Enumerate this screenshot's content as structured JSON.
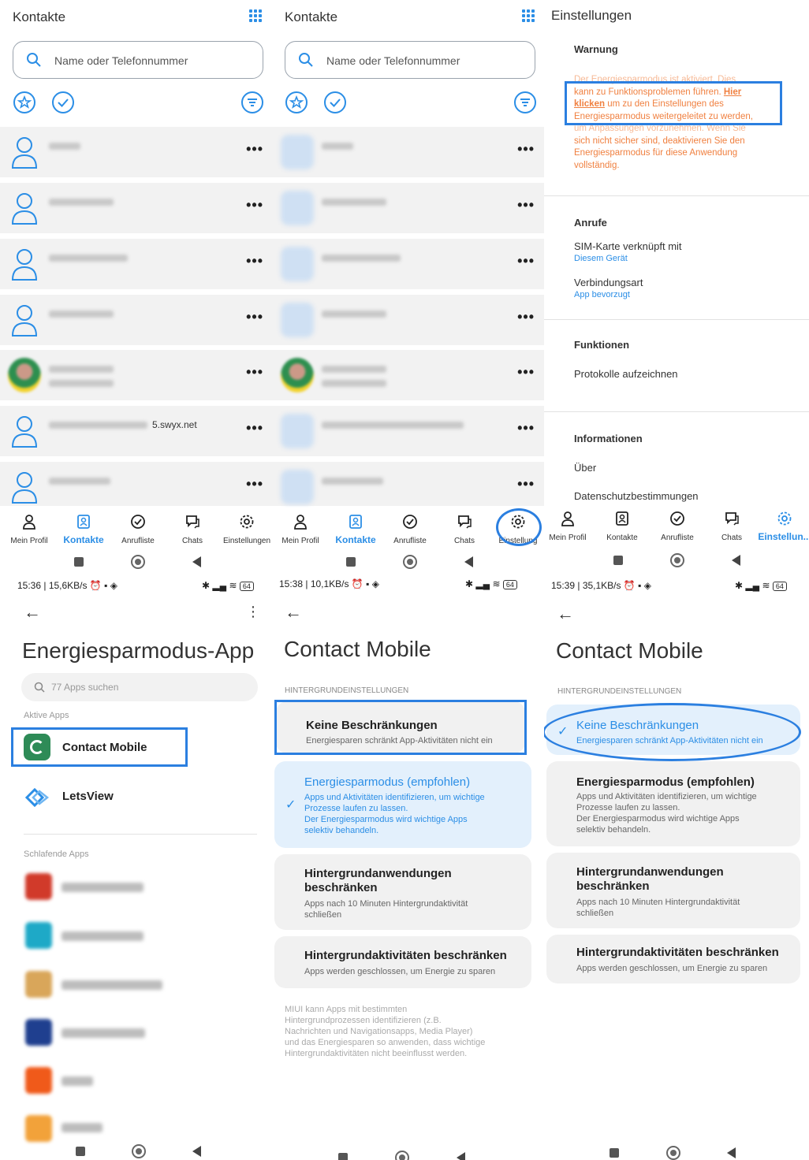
{
  "contacts": {
    "title": "Kontakte",
    "search_placeholder": "Name oder Telefonnummer",
    "row_dots": "•••",
    "row_suffix": "5.swyx.net"
  },
  "nav": {
    "profile": "Mein Profil",
    "contacts": "Kontakte",
    "calls": "Anrufliste",
    "chats": "Chats",
    "settings": "Einstellungen",
    "settings_short": "Einstellun...",
    "settings_cut": "Einstellung"
  },
  "settings": {
    "title": "Einstellungen",
    "warning_head": "Warnung",
    "warning_text_1": "Der Energiesparmodus ist aktiviert. Dies",
    "warning_text_2": "kann zu Funktionsproblemen führen.",
    "warning_link_1": "Hier",
    "warning_link_2": "klicken",
    "warning_text_3": "um zu den Einstellungen des",
    "warning_text_4": "Energiesparmodus weitergeleitet zu werden,",
    "warning_text_5": "um Anpassungen vorzunehmen. Wenn Sie",
    "warning_text_6": "sich nicht sicher sind, deaktivieren Sie den",
    "warning_text_7": "Energiesparmodus für diese Anwendung",
    "warning_text_8": "vollständig.",
    "calls_head": "Anrufe",
    "sim_label": "SIM-Karte verknüpft mit",
    "sim_value": "Diesem Gerät",
    "conn_label": "Verbindungsart",
    "conn_value": "App bevorzugt",
    "func_head": "Funktionen",
    "logs": "Protokolle aufzeichnen",
    "info_head": "Informationen",
    "about": "Über",
    "privacy": "Datenschutzbestimmungen"
  },
  "status": {
    "s1": "15:36 | 15,6KB/s",
    "s2": "15:38 | 10,1KB/s",
    "s3": "15:39 | 35,1KB/s",
    "battery": "64"
  },
  "battery_app": {
    "title": "Energiesparmodus-App",
    "search": "77 Apps suchen",
    "active_head": "Aktive Apps",
    "app1": "Contact Mobile",
    "app2": "LetsView",
    "sleeping_head": "Schlafende Apps"
  },
  "detail": {
    "title": "Contact Mobile",
    "section": "HINTERGRUNDEINSTELLUNGEN",
    "opt1_title": "Keine Beschränkungen",
    "opt1_sub": "Energiesparen schränkt App-Aktivitäten nicht ein",
    "opt2_title": "Energiesparmodus (empfohlen)",
    "opt2_sub_1": "Apps und Aktivitäten identifizieren, um wichtige",
    "opt2_sub_2": "Prozesse laufen zu lassen.",
    "opt2_sub_3": "Der Energiesparmodus wird wichtige Apps",
    "opt2_sub_4": "selektiv behandeln.",
    "opt3_title_1": "Hintergrundanwendungen",
    "opt3_title_2": "beschränken",
    "opt3_sub_1": "Apps nach 10 Minuten Hintergrundaktivität",
    "opt3_sub_2": "schließen",
    "opt4_title": "Hintergrundaktivitäten beschränken",
    "opt4_sub": "Apps werden geschlossen, um Energie zu sparen",
    "note_1": "MIUI kann Apps mit bestimmten",
    "note_2": "Hintergrundprozessen identifizieren (z.B.",
    "note_3": "Nachrichten und Navigationsapps, Media Player)",
    "note_4": "und das Energiesparen so anwenden, dass wichtige",
    "note_5": "Hintergrundaktivitäten nicht beeinflusst werden."
  },
  "icons": {
    "search": "search-icon",
    "dial": "dialpad-icon",
    "favorite": "star-circle-icon",
    "check": "check-circle-icon",
    "filter": "filter-icon"
  },
  "colors": {
    "accent": "#2b8ee6",
    "highlight": "#2b7fe0",
    "warning": "#f08040"
  }
}
